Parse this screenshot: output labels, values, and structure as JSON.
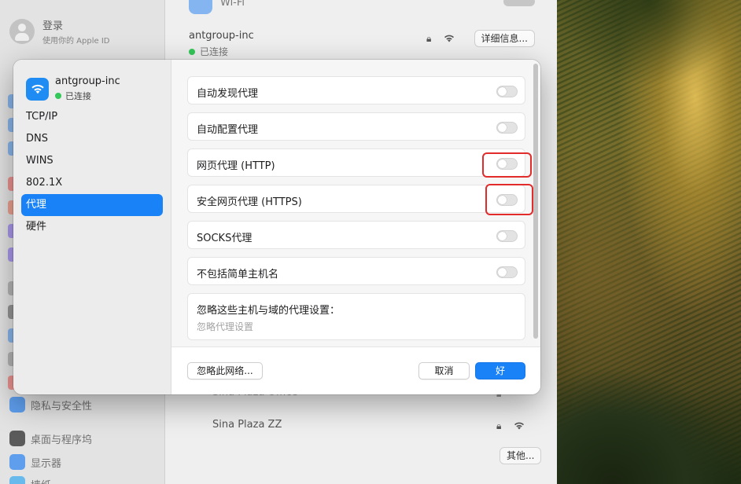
{
  "settings": {
    "account": {
      "title": "登录",
      "subtitle": "使用你的 Apple ID"
    },
    "sidebar_items": [
      {
        "label": "隐私与安全性"
      },
      {
        "label": "桌面与程序坞"
      },
      {
        "label": "显示器"
      },
      {
        "label": "墙纸"
      }
    ],
    "wifi_label": "Wi-Fi",
    "current_network": {
      "name": "antgroup-inc",
      "status": "已连接",
      "details_button": "详细信息..."
    },
    "known_networks": [
      {
        "name": "Sina Plaza Office"
      },
      {
        "name": "Sina Plaza ZZ"
      }
    ],
    "other_button": "其他..."
  },
  "dialog": {
    "network_name": "antgroup-inc",
    "network_status": "已连接",
    "nav": [
      {
        "label": "TCP/IP"
      },
      {
        "label": "DNS"
      },
      {
        "label": "WINS"
      },
      {
        "label": "802.1X"
      },
      {
        "label": "代理"
      },
      {
        "label": "硬件"
      }
    ],
    "active_nav": "代理",
    "proxy_rows": [
      {
        "label": "自动发现代理",
        "enabled": false
      },
      {
        "label": "自动配置代理",
        "enabled": false
      },
      {
        "label": "网页代理 (HTTP)",
        "enabled": false
      },
      {
        "label": "安全网页代理 (HTTPS)",
        "enabled": false
      },
      {
        "label": "SOCKS代理",
        "enabled": false
      },
      {
        "label": "不包括简单主机名",
        "enabled": false
      }
    ],
    "bypass": {
      "label": "忽略这些主机与域的代理设置：",
      "placeholder": "忽略代理设置"
    },
    "forget_button": "忽略此网络...",
    "cancel_button": "取消",
    "ok_button": "好"
  },
  "colors": {
    "accent": "#1a82f7",
    "highlight": "#e22b2b",
    "connected": "#34c759"
  }
}
